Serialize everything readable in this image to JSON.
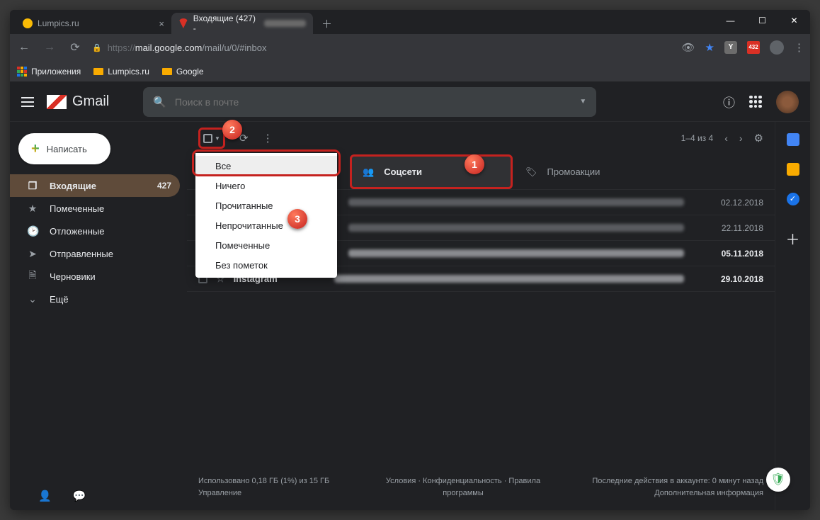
{
  "browser": {
    "tabs": [
      {
        "title": "Lumpics.ru",
        "active": false
      },
      {
        "title": "Входящие (427) -",
        "active": true
      }
    ],
    "url_proto": "https://",
    "url_host": "mail.google.com",
    "url_path": "/mail/u/0/#inbox",
    "ext_badge": "432",
    "bookmarks": {
      "apps": "Приложения",
      "lumpics": "Lumpics.ru",
      "google": "Google"
    }
  },
  "gmail": {
    "brand": "Gmail",
    "search_placeholder": "Поиск в почте",
    "compose": "Написать",
    "nav": [
      {
        "icon": "☐",
        "label": "Входящие",
        "badge": "427",
        "active": true
      },
      {
        "icon": "★",
        "label": "Помеченные"
      },
      {
        "icon": "🕒",
        "label": "Отложенные"
      },
      {
        "icon": "➤",
        "label": "Отправленные"
      },
      {
        "icon": "🗎",
        "label": "Черновики"
      },
      {
        "icon": "⌄",
        "label": "Ещё"
      }
    ],
    "pagination": "1–4 из 4",
    "category_tabs": {
      "social": "Соцсети",
      "promo": "Промоакции"
    },
    "select_menu": [
      "Все",
      "Ничего",
      "Прочитанные",
      "Непрочитанные",
      "Помеченные",
      "Без пометок"
    ],
    "emails": [
      {
        "sender": "",
        "date": "02.12.2018",
        "unread": false
      },
      {
        "sender": "",
        "date": "22.11.2018",
        "unread": false
      },
      {
        "sender": "",
        "date": "05.11.2018",
        "unread": true
      },
      {
        "sender": "Instagram",
        "date": "29.10.2018",
        "unread": true
      }
    ],
    "footer": {
      "storage1": "Использовано 0,18 ГБ (1%) из 15 ГБ",
      "storage2": "Управление",
      "links": "Условия · Конфиденциальность · Правила программы",
      "activity1": "Последние действия в аккаунте: 0 минут назад",
      "activity2": "Дополнительная информация"
    }
  },
  "steps": {
    "s1": "1",
    "s2": "2",
    "s3": "3"
  }
}
